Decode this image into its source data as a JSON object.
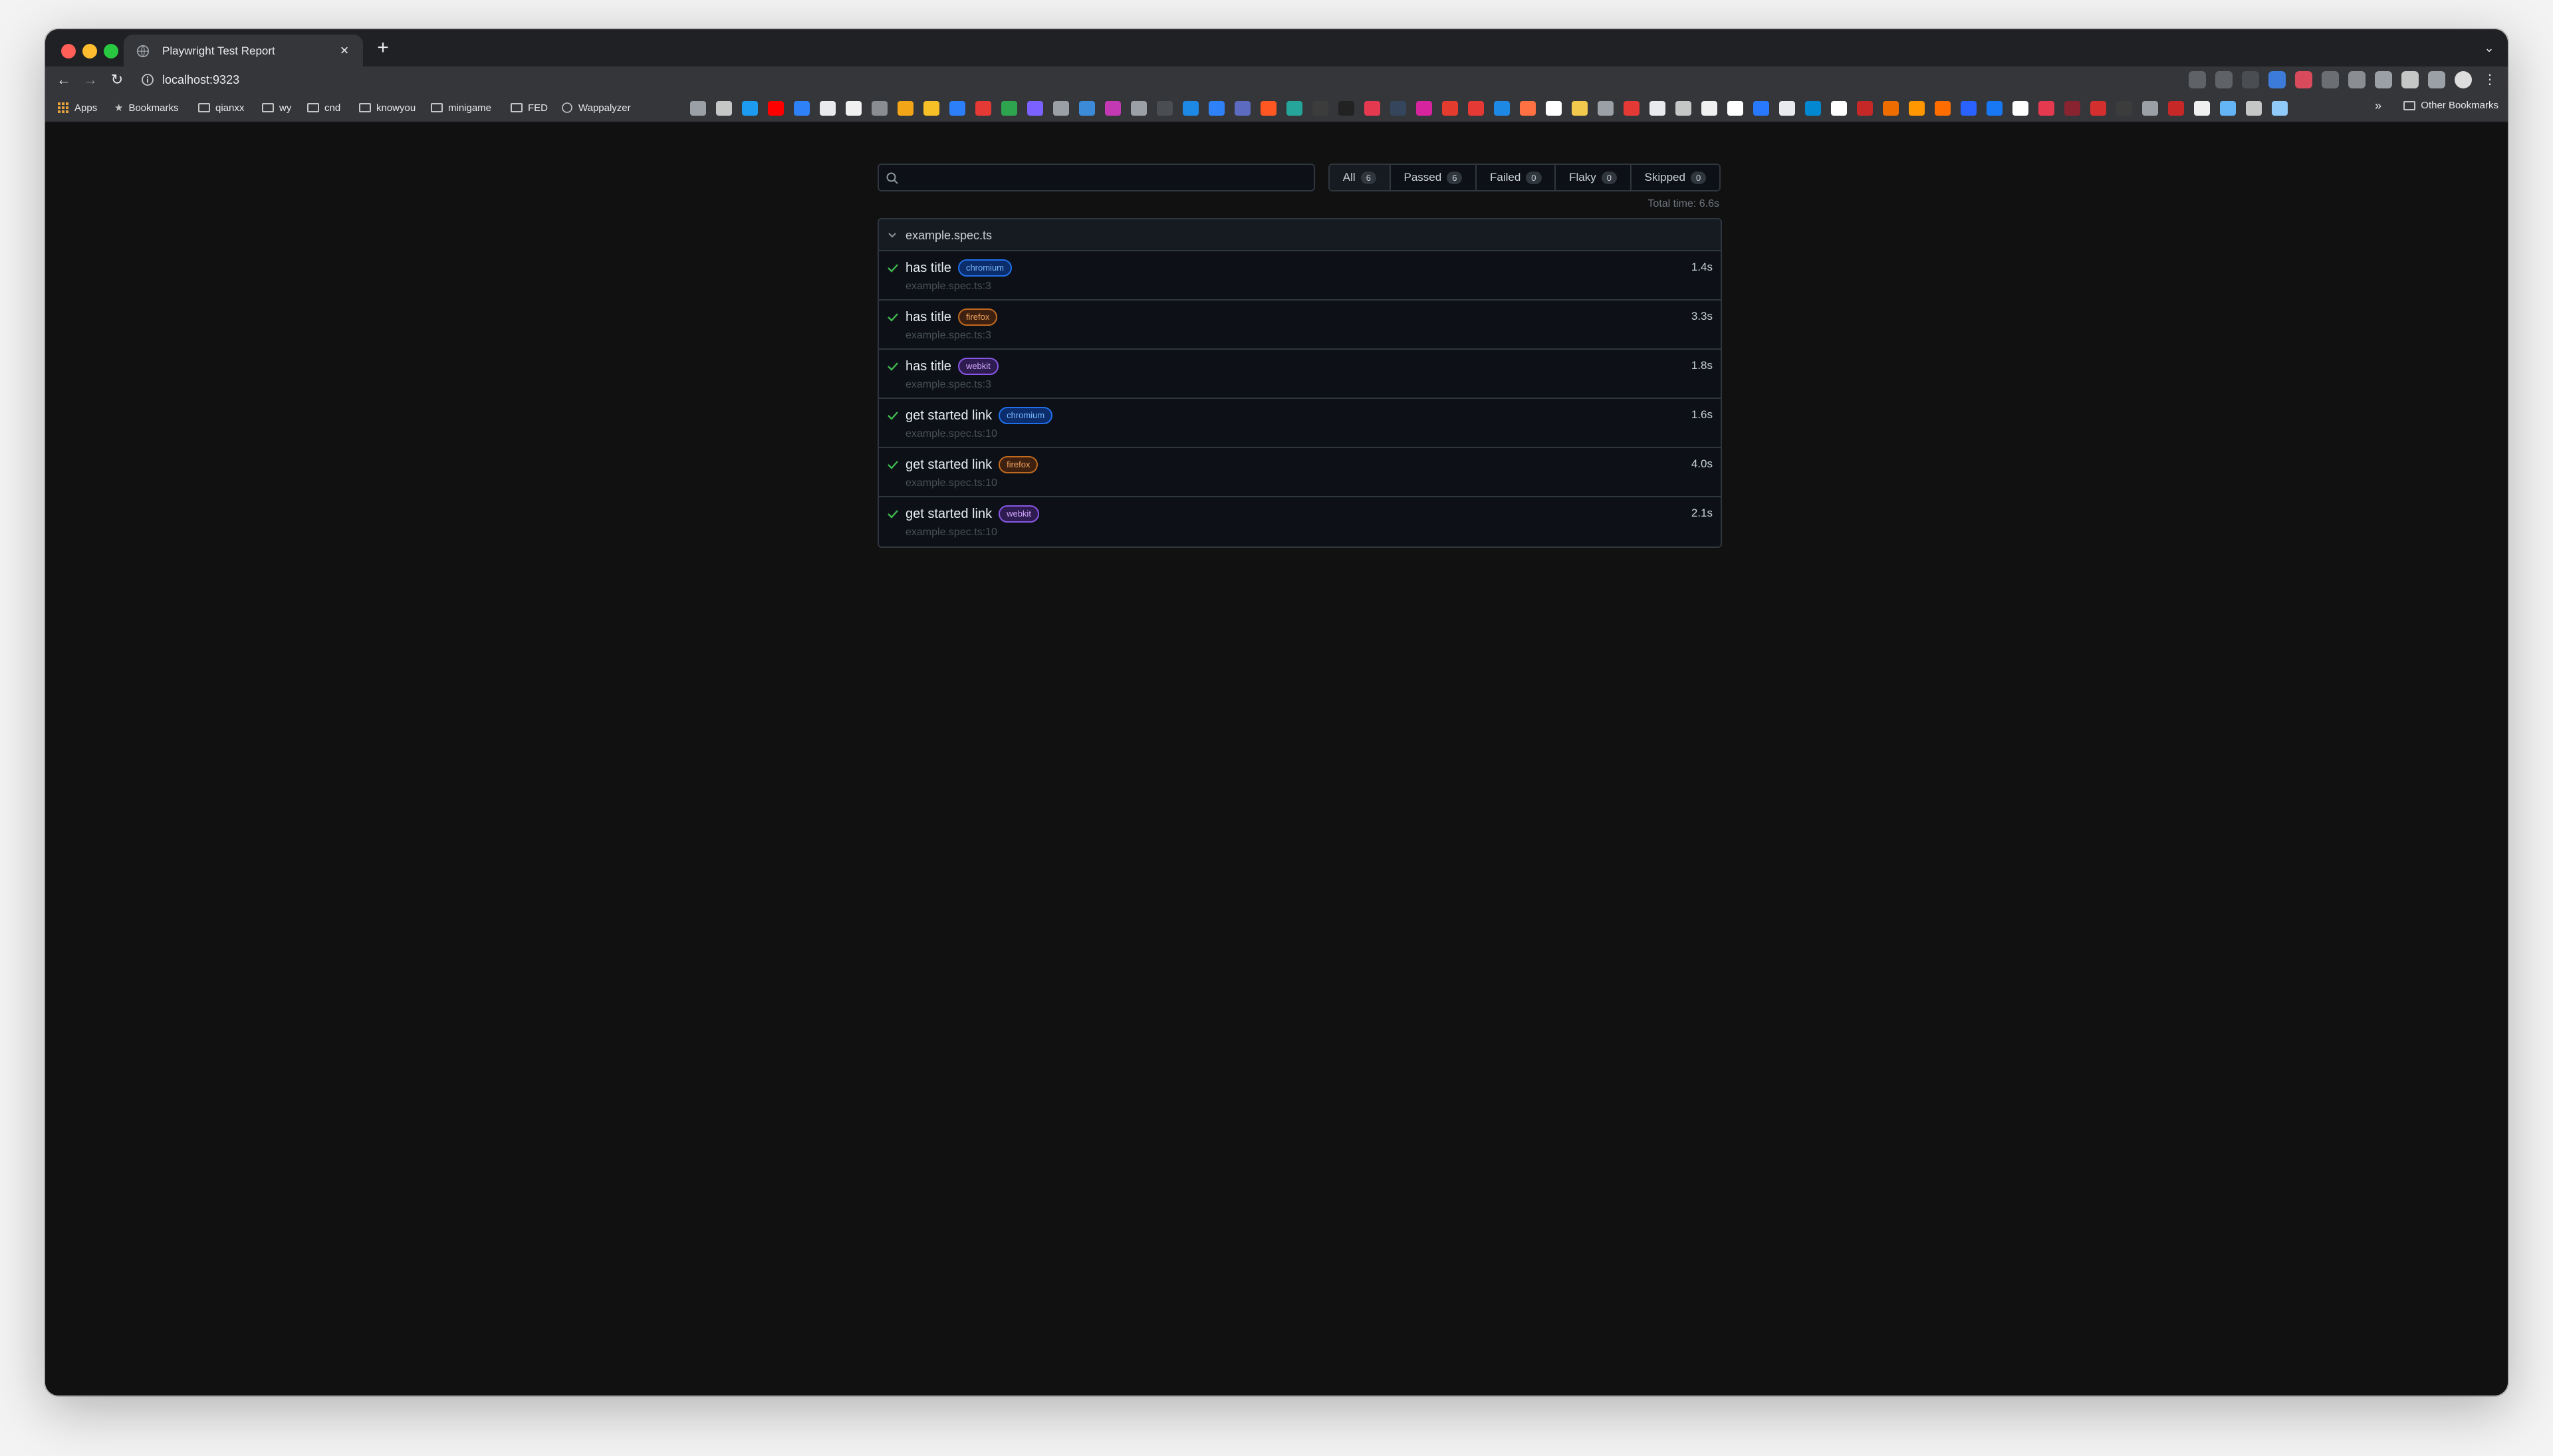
{
  "browser": {
    "tab_title": "Playwright Test Report",
    "url": "localhost:9323",
    "bookmarks": [
      {
        "label": "Apps",
        "icon": "apps-grid-icon"
      },
      {
        "label": "Bookmarks",
        "icon": "star-icon"
      },
      {
        "label": "qianxx",
        "icon": "folder-icon"
      },
      {
        "label": "wy",
        "icon": "folder-icon"
      },
      {
        "label": "cnd",
        "icon": "folder-icon"
      },
      {
        "label": "knowyou",
        "icon": "folder-icon"
      },
      {
        "label": "minigame",
        "icon": "folder-icon"
      },
      {
        "label": "FED",
        "icon": "folder-icon"
      },
      {
        "label": "Wappalyzer",
        "icon": "globe-icon"
      }
    ],
    "other_bookmarks": "Other Bookmarks",
    "more_glyph": "»"
  },
  "report": {
    "search_placeholder": "",
    "filters": [
      {
        "label": "All",
        "count": "6"
      },
      {
        "label": "Passed",
        "count": "6"
      },
      {
        "label": "Failed",
        "count": "0"
      },
      {
        "label": "Flaky",
        "count": "0"
      },
      {
        "label": "Skipped",
        "count": "0"
      }
    ],
    "total_time": "Total time: 6.6s",
    "file_name": "example.spec.ts",
    "tests": [
      {
        "title": "has title",
        "project": "chromium",
        "location": "example.spec.ts:3",
        "duration": "1.4s"
      },
      {
        "title": "has title",
        "project": "firefox",
        "location": "example.spec.ts:3",
        "duration": "3.3s"
      },
      {
        "title": "has title",
        "project": "webkit",
        "location": "example.spec.ts:3",
        "duration": "1.8s"
      },
      {
        "title": "get started link",
        "project": "chromium",
        "location": "example.spec.ts:10",
        "duration": "1.6s"
      },
      {
        "title": "get started link",
        "project": "firefox",
        "location": "example.spec.ts:10",
        "duration": "4.0s"
      },
      {
        "title": "get started link",
        "project": "webkit",
        "location": "example.spec.ts:10",
        "duration": "2.1s"
      }
    ]
  },
  "colors": {
    "page_bg": "#111111",
    "border": "#30363d",
    "pass_green": "#3fb950",
    "chromium": "#1f6feb",
    "firefox": "#c06a1f",
    "webkit": "#8957e5"
  }
}
